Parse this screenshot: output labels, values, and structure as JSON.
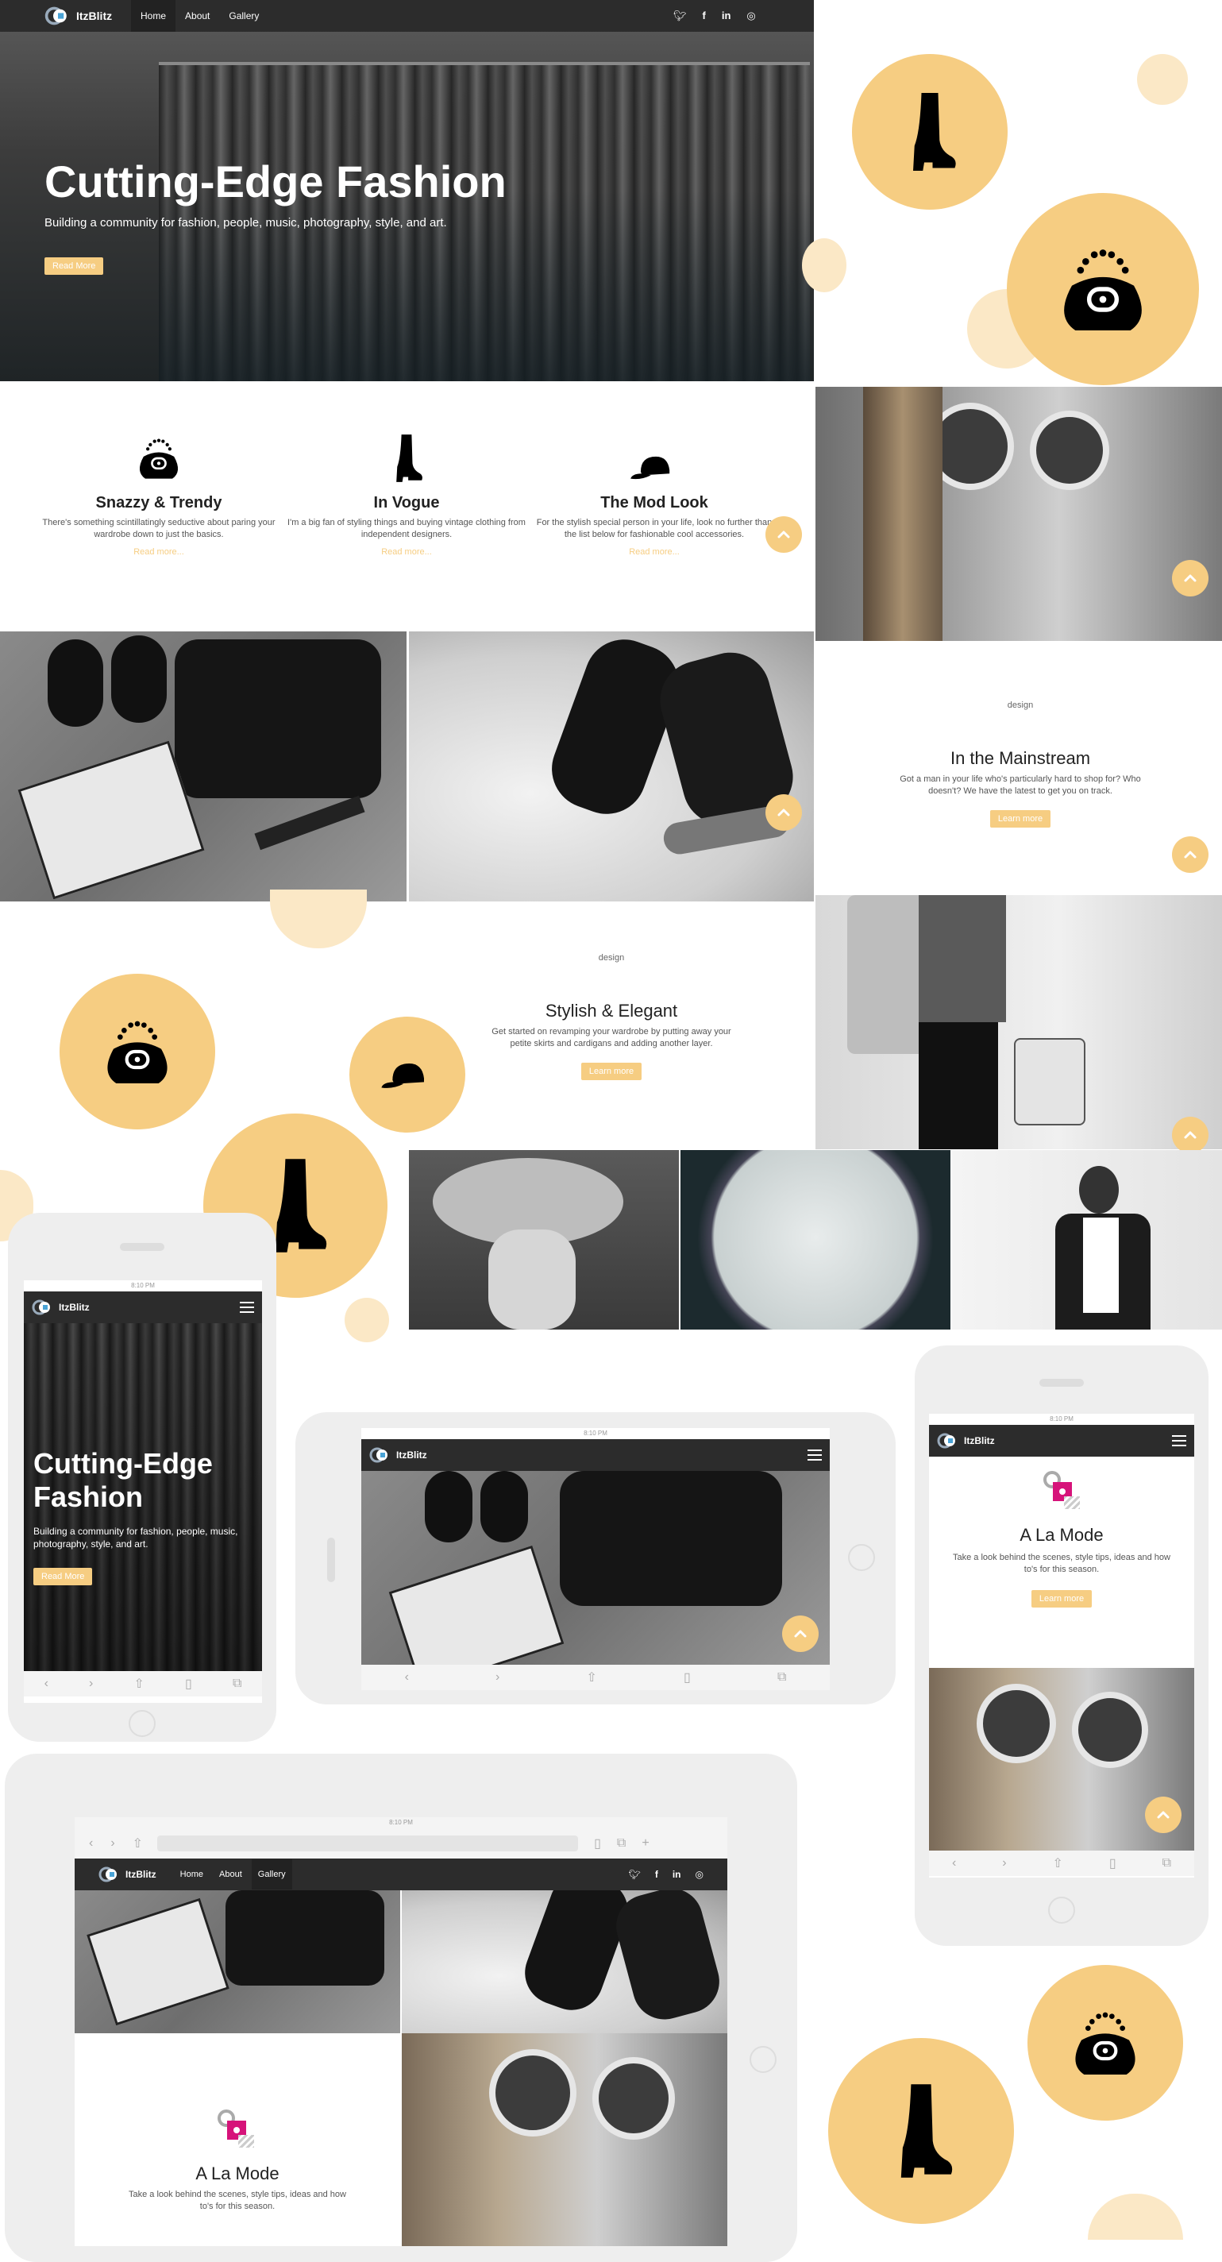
{
  "brand": {
    "name": "ItzBlitz"
  },
  "nav": {
    "items": [
      "Home",
      "About",
      "Gallery"
    ],
    "active": "Home",
    "social": [
      "twitter-icon",
      "facebook-icon",
      "linkedin-icon",
      "instagram-icon"
    ]
  },
  "hero": {
    "title": "Cutting-Edge Fashion",
    "subtitle": "Building a community for fashion, people, music, photography, style, and art.",
    "button": "Read More"
  },
  "features": [
    {
      "icon": "handbag-icon",
      "title": "Snazzy & Trendy",
      "text": "There's something scintillatingly seductive about paring your wardrobe down to just the basics.",
      "link": "Read more..."
    },
    {
      "icon": "boot-icon",
      "title": "In Vogue",
      "text": "I'm a big fan of styling things and buying vintage clothing from independent designers.",
      "link": "Read more..."
    },
    {
      "icon": "cap-icon",
      "title": "The Mod Look",
      "text": "For the stylish special person in your life, look no further than the list below for fashionable cool accessories.",
      "link": "Read more..."
    }
  ],
  "mainstream": {
    "img_alt": "design",
    "title": "In the Mainstream",
    "text": "Got a man in your life who's particularly hard to shop for? Who doesn't? We have the latest to get you on track.",
    "button": "Learn more"
  },
  "elegant": {
    "img_alt": "design",
    "title": "Stylish & Elegant",
    "text": "Get started on revamping your wardrobe by putting away your petite skirts and cardigans and adding another layer.",
    "button": "Learn more"
  },
  "phone_left": {
    "status_time": "8:10 PM",
    "hero_title": "Cutting-Edge Fashion",
    "hero_subtitle": "Building a community for fashion, people, music, photography, style, and art.",
    "button": "Read More"
  },
  "tablet_mid": {
    "status_time": "8:10 PM"
  },
  "phone_right": {
    "status_time": "8:10 PM",
    "title": "A La Mode",
    "text": "Take a look behind the scenes, style tips, ideas and how to's for this season.",
    "button": "Learn more"
  },
  "tablet_bottom": {
    "status_time": "8:10 PM",
    "title": "A La Mode",
    "text": "Take a look behind the scenes, style tips, ideas and how to's for this season."
  },
  "colors": {
    "accent": "#f6cd82",
    "dark_nav": "#2c2c2c",
    "accent_pink": "#d6137a"
  }
}
